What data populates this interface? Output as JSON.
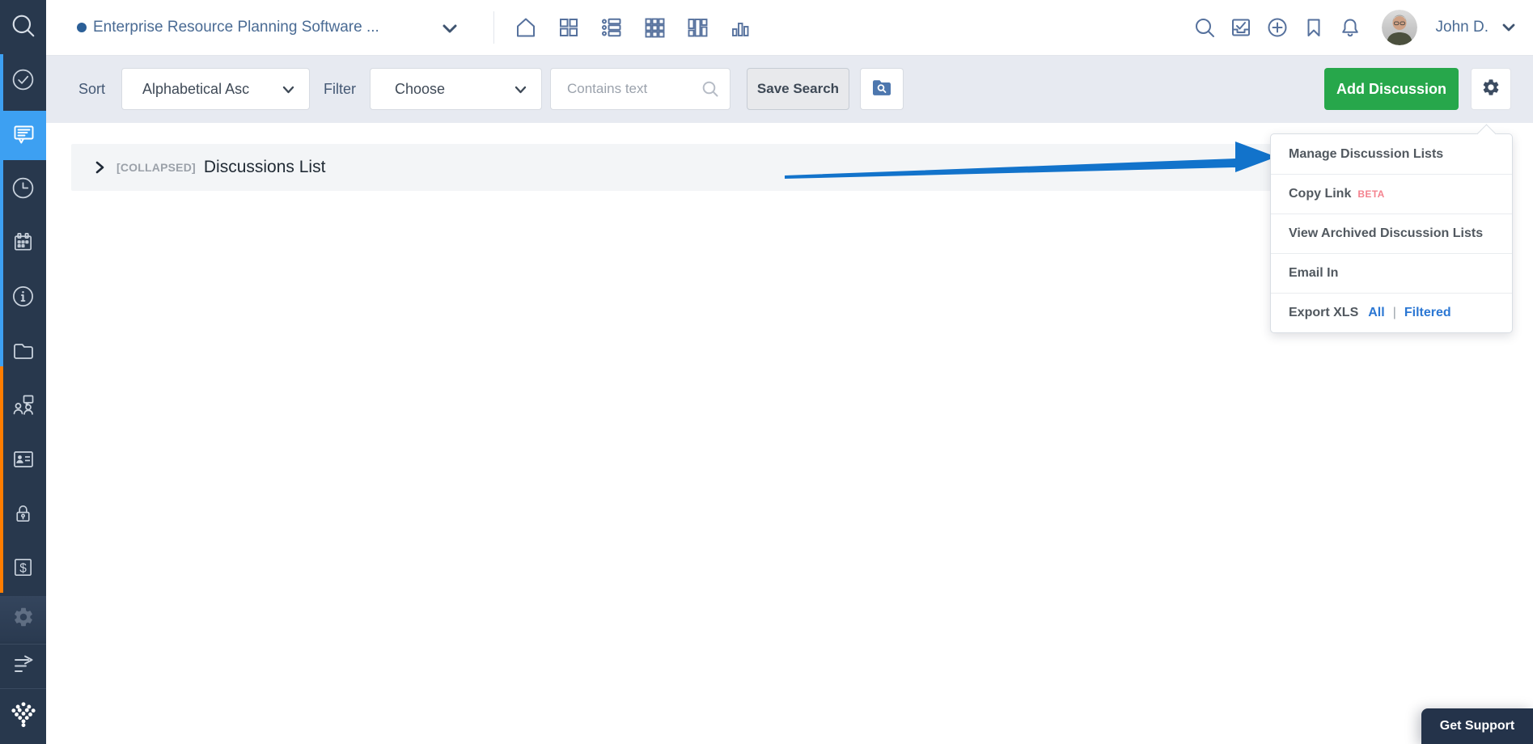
{
  "sidebar": {
    "items": [
      {
        "icon": "search-icon"
      },
      {
        "icon": "check-circle-icon"
      },
      {
        "icon": "discussions-icon",
        "active": true
      },
      {
        "icon": "clock-icon"
      },
      {
        "icon": "calendar-icon"
      },
      {
        "icon": "info-icon"
      },
      {
        "icon": "folder-icon"
      },
      {
        "icon": "team-discussion-icon"
      },
      {
        "icon": "contacts-icon"
      },
      {
        "icon": "lock-icon"
      },
      {
        "icon": "billing-icon"
      },
      {
        "icon": "settings-icon-dimmed"
      },
      {
        "icon": "collapse-arrow-icon"
      },
      {
        "icon": "company-logo"
      }
    ],
    "active_color": "#3DA0F2",
    "accent_blue": "#3DA0F2",
    "accent_orange": "#FF7D00"
  },
  "header": {
    "project_title": "Enterprise Resource Planning Software ...",
    "status_dot_color": "#2B5F97",
    "view_icons": [
      "home-icon",
      "grid-2x2-icon",
      "list-view-icon",
      "grid-3x3-icon",
      "columns-view-icon",
      "bar-chart-icon"
    ],
    "action_icons": [
      "search-icon",
      "tasks-inbox-icon",
      "add-circle-icon",
      "bookmark-icon",
      "notifications-icon"
    ],
    "user_name": "John D."
  },
  "toolbar": {
    "sort_label": "Sort",
    "sort_value": "Alphabetical Asc",
    "filter_label": "Filter",
    "filter_value": "Choose",
    "search_placeholder": "Contains text",
    "save_search_label": "Save Search",
    "add_discussion_label": "Add Discussion",
    "add_button_color": "#27A74B"
  },
  "content": {
    "collapsed_tag": "[COLLAPSED]",
    "section_title": "Discussions List"
  },
  "gear_menu": {
    "items": [
      {
        "label": "Manage Discussion Lists"
      },
      {
        "label": "Copy Link",
        "badge": "BETA"
      },
      {
        "label": "View Archived Discussion Lists"
      },
      {
        "label": "Email In"
      },
      {
        "label": "Export XLS",
        "links": [
          "All",
          "Filtered"
        ],
        "separator": "|"
      }
    ],
    "badge_color": "#F4838F",
    "link_color": "#2B77D3"
  },
  "annotation": {
    "arrow_color": "#1273CB"
  },
  "support": {
    "label": "Get Support"
  }
}
